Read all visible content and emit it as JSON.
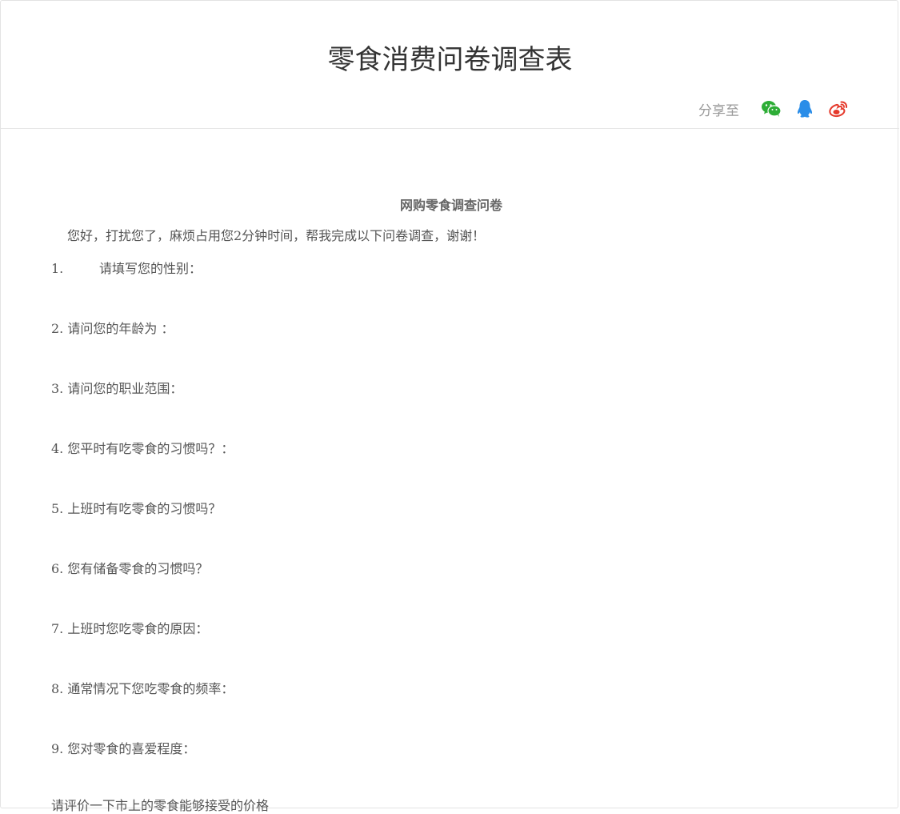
{
  "header": {
    "title": "零食消费问卷调查表",
    "share_label": "分享至",
    "share_icons": [
      {
        "icon": "wechat-icon",
        "color": "#2dad36"
      },
      {
        "icon": "qq-icon",
        "color": "#2a8de8"
      },
      {
        "icon": "weibo-icon",
        "color": "#e5392b"
      }
    ]
  },
  "survey": {
    "heading": "网购零食调查问卷",
    "intro": "您好，打扰您了，麻烦占用您2分钟时间，帮我完成以下问卷调查，谢谢！",
    "questions": [
      {
        "num": "1.",
        "text": "请填写您的性别："
      },
      {
        "num": "2.",
        "text": "请问您的年龄为 ："
      },
      {
        "num": "3.",
        "text": "请问您的职业范围："
      },
      {
        "num": "4.",
        "text": "您平时有吃零食的习惯吗？："
      },
      {
        "num": "5.",
        "text": "上班时有吃零食的习惯吗？"
      },
      {
        "num": "6.",
        "text": "您有储备零食的习惯吗？"
      },
      {
        "num": "7.",
        "text": "上班时您吃零食的原因："
      },
      {
        "num": "8.",
        "text": "通常情况下您吃零食的频率："
      },
      {
        "num": "9.",
        "text": "您对零食的喜爱程度："
      }
    ],
    "partial_question": "请评价一下市上的零食能够接受的价格"
  }
}
